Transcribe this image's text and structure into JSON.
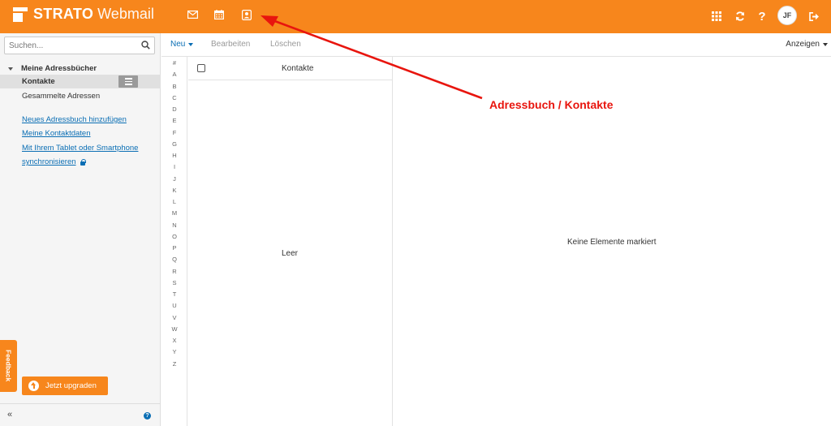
{
  "header": {
    "brand": "STRATO",
    "product": "Webmail",
    "avatar_initials": "JF",
    "accent": "#f7861c",
    "apps": [
      {
        "icon": "mail-icon"
      },
      {
        "icon": "calendar-icon"
      },
      {
        "icon": "contacts-icon"
      }
    ],
    "right_icons": [
      "apps-grid-icon",
      "refresh-icon",
      "help-icon",
      "logout-icon"
    ],
    "help_label": "?"
  },
  "sidebar": {
    "search_placeholder": "Suchen...",
    "section_title": "Meine Adressbücher",
    "active_item": "Kontakte",
    "item": "Gesammelte Adressen",
    "links": [
      "Neues Adressbuch hinzufügen",
      "Meine Kontaktdaten",
      "Mit Ihrem Tablet oder Smartphone",
      "synchronisieren"
    ],
    "feedback_label": "Feedback",
    "upgrade_label": "Jetzt upgraden",
    "collapse_label": "«",
    "help_label": "?"
  },
  "toolbar": {
    "new_label": "Neu",
    "edit_label": "Bearbeiten",
    "delete_label": "Löschen",
    "view_label": "Anzeigen"
  },
  "alphabet": [
    "#",
    "A",
    "B",
    "C",
    "D",
    "E",
    "F",
    "G",
    "H",
    "I",
    "J",
    "K",
    "L",
    "M",
    "N",
    "O",
    "P",
    "Q",
    "R",
    "S",
    "T",
    "U",
    "V",
    "W",
    "X",
    "Y",
    "Z"
  ],
  "list": {
    "column_title": "Kontakte",
    "empty_text": "Leer"
  },
  "detail": {
    "empty_text": "Keine Elemente markiert"
  },
  "annotation": {
    "text": "Adressbuch / Kontakte",
    "color": "#e8150e"
  }
}
